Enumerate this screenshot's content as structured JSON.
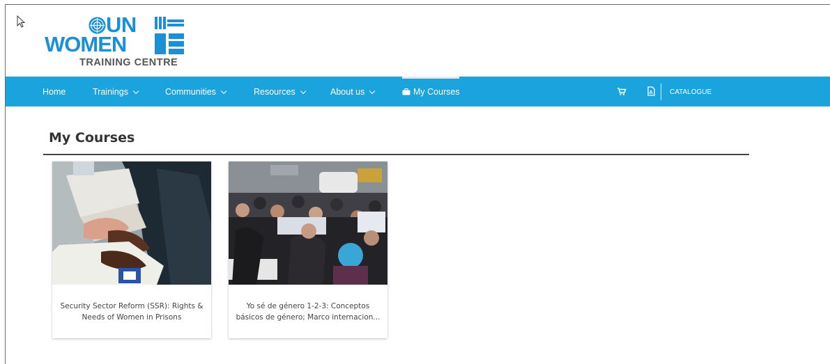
{
  "logo": {
    "line1": "UN",
    "line2": "WOMEN",
    "line3": "TRAINING CENTRE"
  },
  "nav": {
    "home": "Home",
    "trainings": "Trainings",
    "communities": "Communities",
    "resources": "Resources",
    "about": "About us",
    "my_courses": "My Courses",
    "catalogue": "CATALOGUE",
    "icons": [
      "cart-icon",
      "pdf-icon",
      "briefcase-icon"
    ]
  },
  "page": {
    "title": "My Courses"
  },
  "courses": [
    {
      "title": "Security Sector Reform (SSR): Rights & Needs of Women in Prisons"
    },
    {
      "title": "Yo sé de género 1-2-3: Conceptos básicos de género; Marco internacion..."
    }
  ],
  "colors": {
    "nav_bg": "#1aa3dc",
    "brand_blue": "#1c8fd6"
  }
}
